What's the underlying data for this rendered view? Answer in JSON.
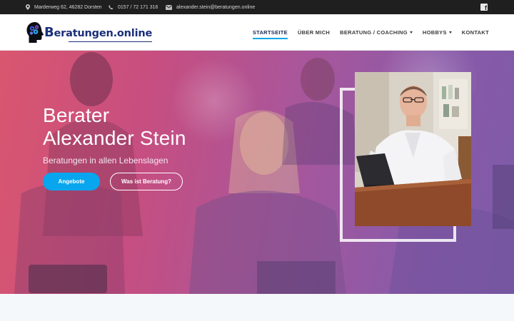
{
  "topbar": {
    "address": "Marderweg 62, 46282 Dorsten",
    "phone": "0157 / 72 171 316",
    "email": "alexander.stein@beratungen.online",
    "icons": [
      "location-pin-icon",
      "phone-icon",
      "envelope-icon",
      "facebook-icon"
    ]
  },
  "logo": {
    "first_letter": "B",
    "rest": "eratungen.online"
  },
  "nav": {
    "items": [
      {
        "label": "STARTSEITE",
        "active": true,
        "dropdown": false
      },
      {
        "label": "ÜBER MICH",
        "active": false,
        "dropdown": false
      },
      {
        "label": "BERATUNG / COACHING",
        "active": false,
        "dropdown": true
      },
      {
        "label": "HOBBYS",
        "active": false,
        "dropdown": true
      },
      {
        "label": "KONTAKT",
        "active": false,
        "dropdown": false
      }
    ]
  },
  "hero": {
    "title_line1": "Berater",
    "title_line2": "Alexander Stein",
    "subtitle": "Beratungen in allen Lebenslagen",
    "primary_button": "Angebote",
    "secondary_button": "Was ist Beratung?"
  },
  "colors": {
    "accent": "#07a6ee",
    "brand": "#1b2f7a",
    "topbar": "#1f1f1f"
  }
}
